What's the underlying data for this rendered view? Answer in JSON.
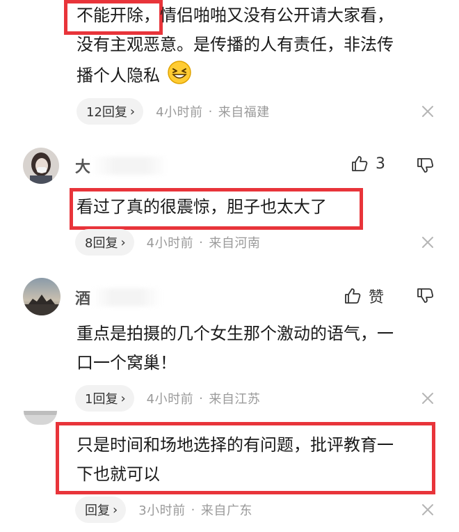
{
  "comments": [
    {
      "body_line1_a": "不能开除",
      "body_line1_b": "，情侣啪啪又没有公开请大家看，",
      "body_line2": "没有主观恶意。是传播的人有责任，非法传",
      "body_line3": "播个人隐私",
      "emoji": "grinning-squint-emoji",
      "reply_label": "12回复",
      "time": "4小时前",
      "location": "来自福建"
    },
    {
      "username": "大",
      "like_count": "3",
      "body": "看过了真的很震惊，胆子也太大了",
      "reply_label": "8回复",
      "time": "4小时前",
      "location": "来自河南"
    },
    {
      "username": "酒",
      "like_label": "赞",
      "body_line1": "重点是拍摄的几个女生那个激动的语气，一",
      "body_line2": "口一个窝巢！",
      "reply_label": "1回复",
      "time": "4小时前",
      "location": "来自江苏"
    },
    {
      "body_line1": "只是时间和场地选择的有问题，批评教育一",
      "body_line2": "下也就可以",
      "reply_label": "回复",
      "time": "3小时前",
      "location": "来自广东"
    }
  ],
  "ui": {
    "separator": "·",
    "chevron": "›",
    "highlight_color": "#e8343a",
    "meta_color": "#9a9a9a",
    "icons": [
      "thumbs-up-icon",
      "thumbs-down-icon",
      "close-icon",
      "chevron-right-icon"
    ]
  }
}
